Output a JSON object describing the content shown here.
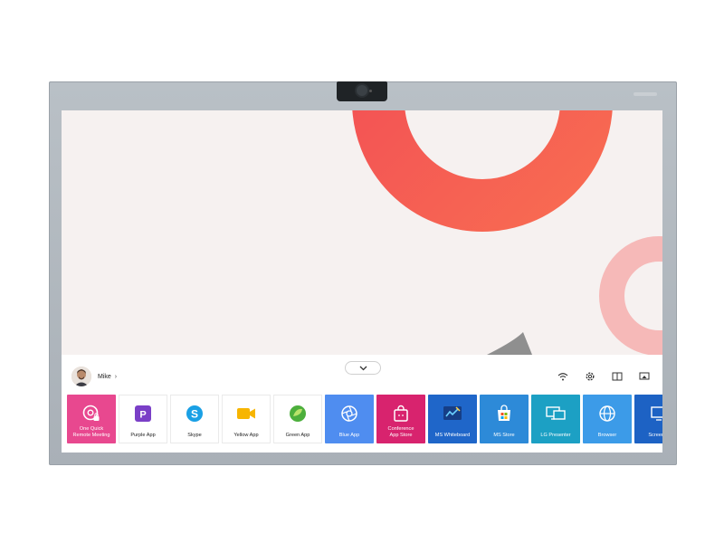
{
  "user": {
    "name": "Mike",
    "chevron": "›"
  },
  "colors": {
    "pink": "#e8488f",
    "magenta": "#d8236e",
    "blue_app": "#4f8df0",
    "ms_whiteboard": "#1f66c9",
    "ms_store": "#2d8ad8",
    "lg_presenter": "#1ca0c4",
    "browser": "#3c9be8",
    "screen_share": "#1d62c4",
    "purple": "#7a3fc7",
    "skype": "#1aa0e5",
    "yellow": "#f7b500",
    "green": "#4caf3c",
    "ring_main": "#f25e54",
    "ring_small": "#f6b6b4"
  },
  "system_icons": [
    "wifi-icon",
    "settings-icon",
    "split-view-icon",
    "screen-share-icon"
  ],
  "apps": [
    {
      "label": "One Quick\nRemote Meeting",
      "icon": "camera-lock-icon",
      "style": "dark",
      "color": "#e8488f"
    },
    {
      "label": "Purple App",
      "icon": "purple-p-icon",
      "style": "light",
      "color": "#7a3fc7"
    },
    {
      "label": "Skype",
      "icon": "skype-icon",
      "style": "light",
      "color": "#1aa0e5"
    },
    {
      "label": "Yellow App",
      "icon": "video-camera-icon",
      "style": "light",
      "color": "#f7b500"
    },
    {
      "label": "Green App",
      "icon": "green-leaf-icon",
      "style": "light",
      "color": "#4caf3c"
    },
    {
      "label": "Blue App",
      "icon": "aperture-icon",
      "style": "dark",
      "color": "#4f8df0"
    },
    {
      "label": "Conference\nApp Store",
      "icon": "store-bag-icon",
      "style": "dark",
      "color": "#d8236e"
    },
    {
      "label": "MS Whiteboard",
      "icon": "whiteboard-icon",
      "style": "dark",
      "color": "#1f66c9"
    },
    {
      "label": "MS Store",
      "icon": "ms-store-icon",
      "style": "dark",
      "color": "#2d8ad8"
    },
    {
      "label": "LG Presenter",
      "icon": "presenter-icon",
      "style": "dark",
      "color": "#1ca0c4"
    },
    {
      "label": "Browser",
      "icon": "globe-icon",
      "style": "dark",
      "color": "#3c9be8"
    },
    {
      "label": "Screen C",
      "icon": "screen-cast-icon",
      "style": "dark",
      "color": "#1d62c4"
    }
  ]
}
